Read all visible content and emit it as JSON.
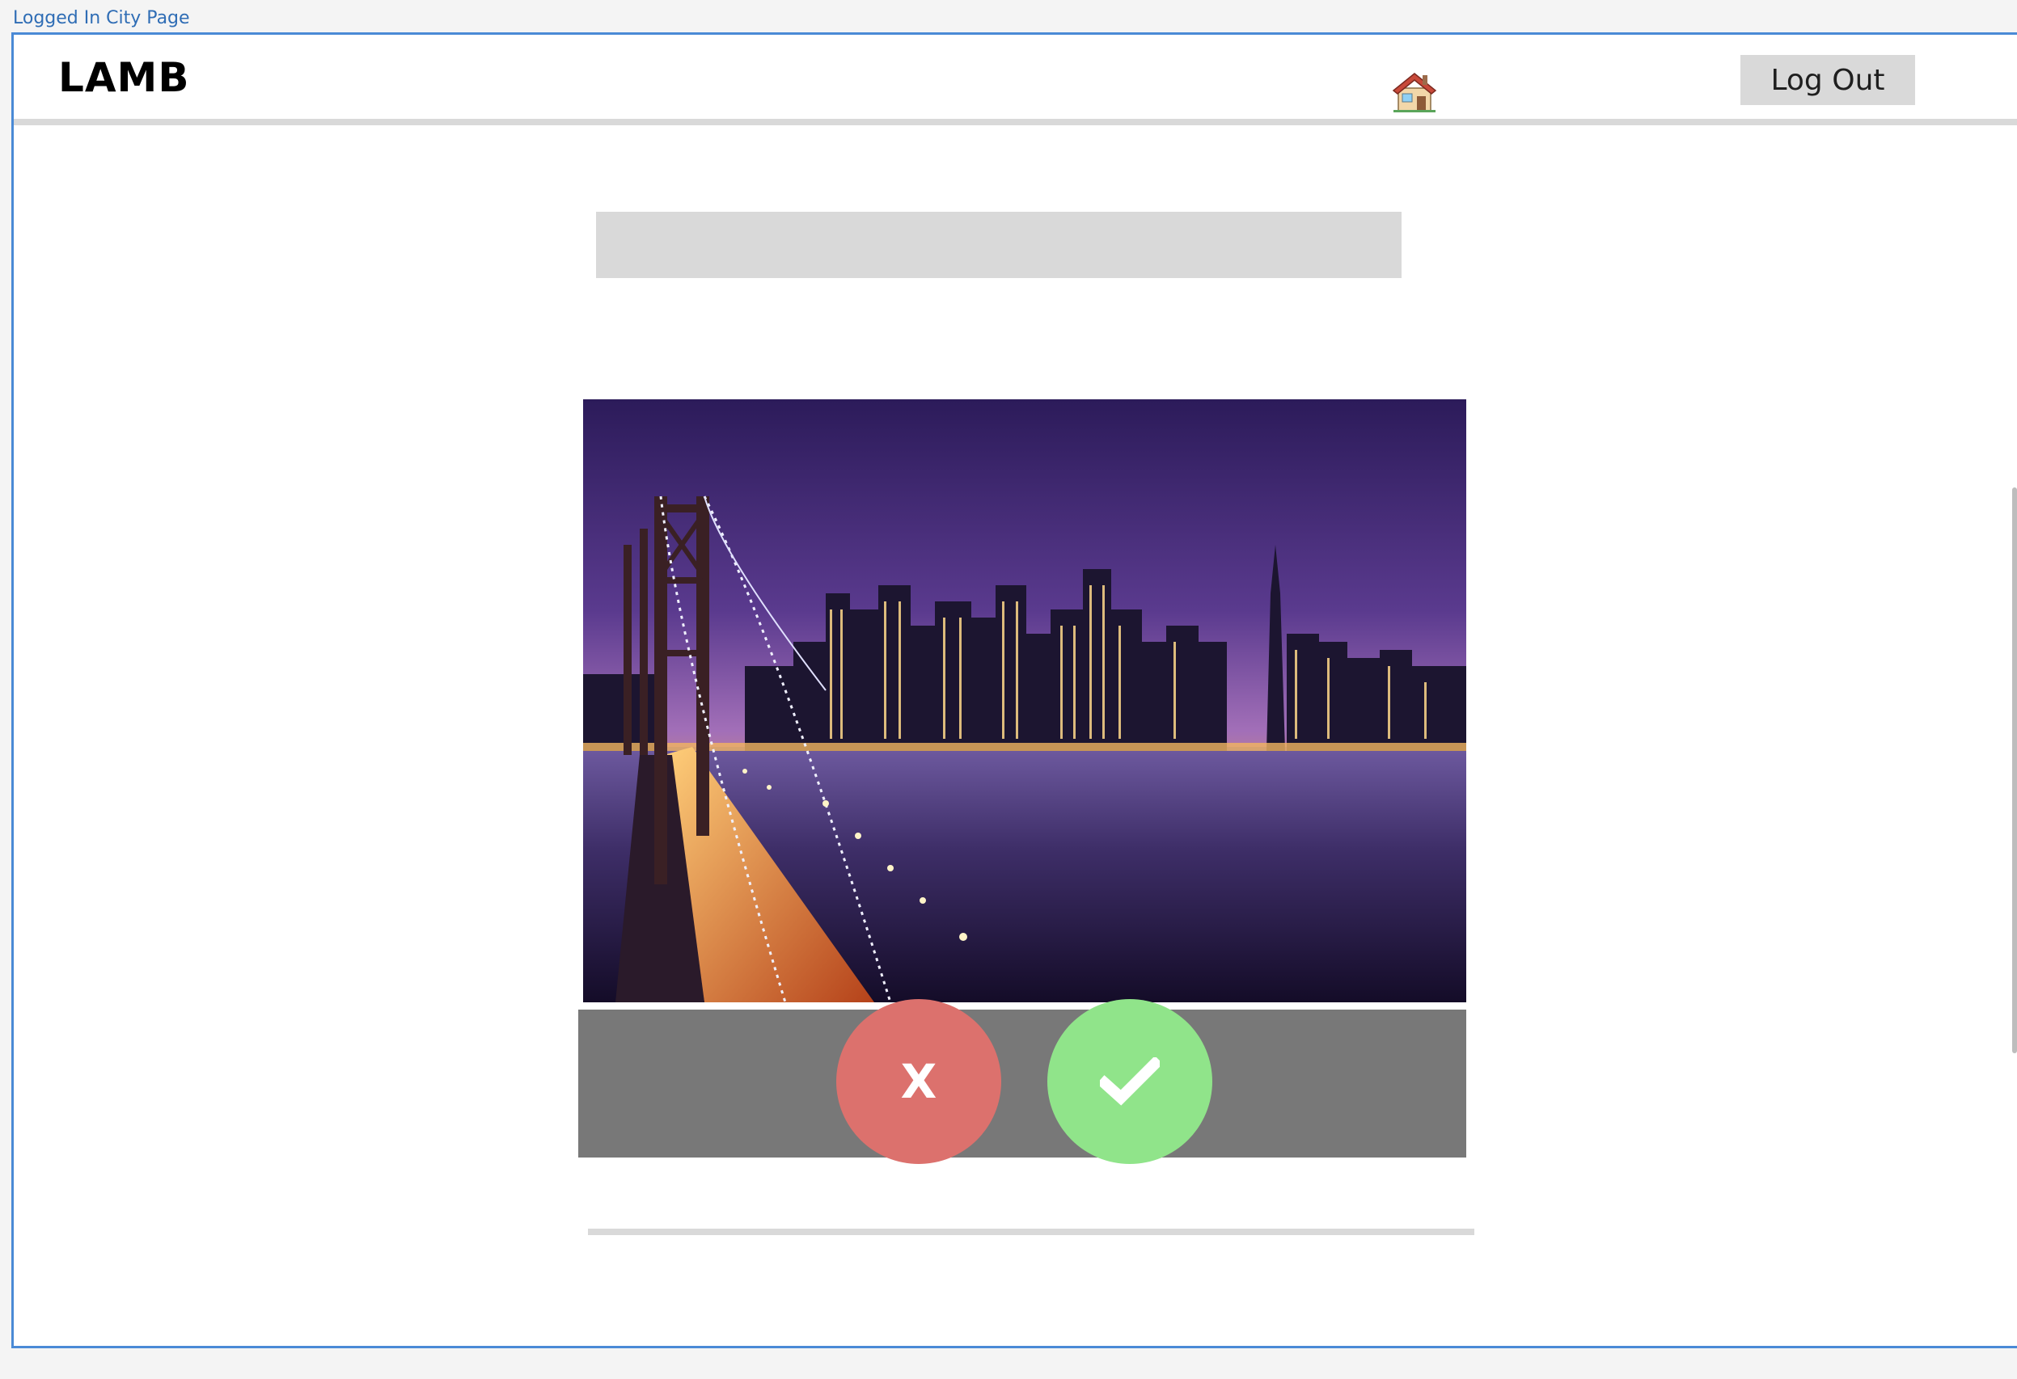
{
  "frame": {
    "label": "Logged In City Page"
  },
  "header": {
    "logo_text": "LAMB",
    "home_icon": "house-icon",
    "logout_label": "Log Out"
  },
  "main": {
    "photo_icon": "city-skyline-bridge-photo",
    "reject_label": "X",
    "accept_icon": "checkmark-icon"
  },
  "colors": {
    "accent_frame": "#4a8ad6",
    "reject": "#dc716d",
    "accept": "#90e48a",
    "action_bar": "#787878",
    "placeholder": "#d9d9d9"
  }
}
